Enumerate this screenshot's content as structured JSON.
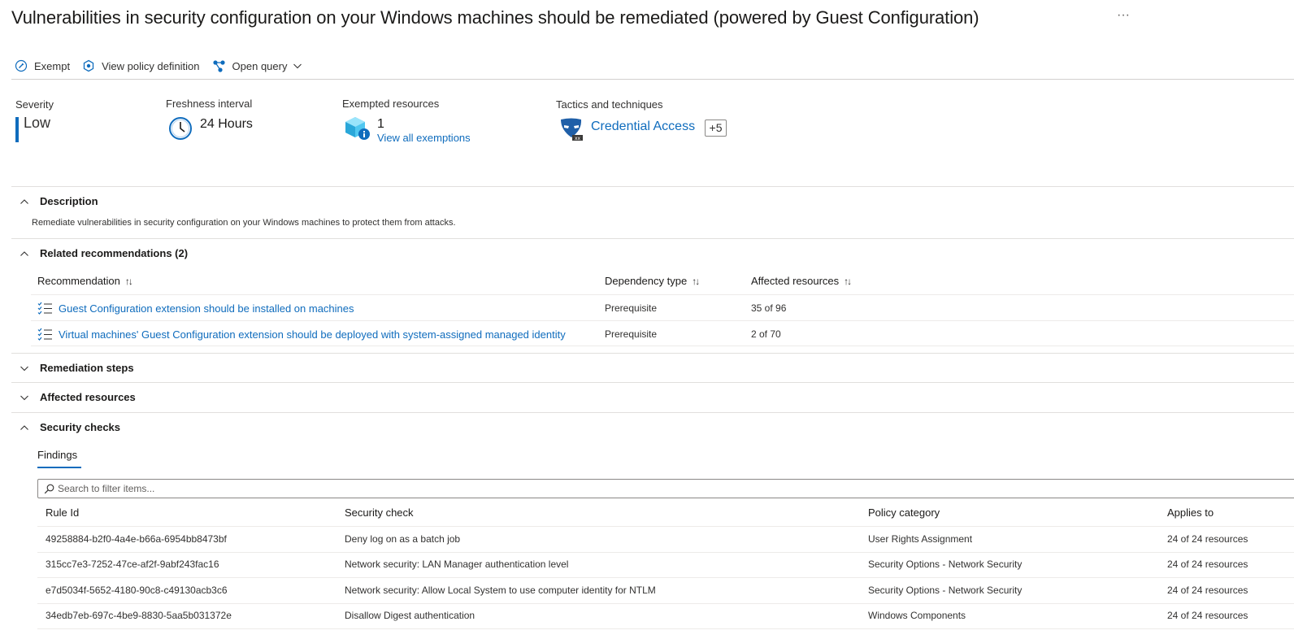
{
  "page": {
    "title": "Vulnerabilities in security configuration on your Windows machines should be remediated (powered by Guest Configuration)",
    "more": "···"
  },
  "toolbar": {
    "exempt": "Exempt",
    "view_policy": "View policy definition",
    "open_query": "Open query"
  },
  "summary": {
    "severity_label": "Severity",
    "severity_value": "Low",
    "freshness_label": "Freshness interval",
    "freshness_value": "24 Hours",
    "exempted_label": "Exempted resources",
    "exempted_count": "1",
    "exempted_link": "View all exemptions",
    "tactics_label": "Tactics and techniques",
    "tactics_value": "Credential Access",
    "tactics_more": "+5"
  },
  "description": {
    "title": "Description",
    "text": "Remediate vulnerabilities in security configuration on your Windows machines to protect them from attacks."
  },
  "related": {
    "title": "Related recommendations (2)",
    "headers": [
      "Recommendation",
      "Dependency type",
      "Affected resources"
    ],
    "sort_glyph": "↑↓",
    "rows": [
      {
        "recommendation": "Guest Configuration extension should be installed on machines",
        "dependency": "Prerequisite",
        "affected": "35 of 96"
      },
      {
        "recommendation": "Virtual machines' Guest Configuration extension should be deployed with system-assigned managed identity",
        "dependency": "Prerequisite",
        "affected": "2 of 70"
      }
    ]
  },
  "remediation": {
    "title": "Remediation steps"
  },
  "affected": {
    "title": "Affected resources"
  },
  "security_checks": {
    "title": "Security checks",
    "tab": "Findings",
    "filter_placeholder": "Search to filter items...",
    "headers": [
      "Rule Id",
      "Security check",
      "Policy category",
      "Applies to"
    ],
    "rows": [
      {
        "rule_id": "49258884-b2f0-4a4e-b66a-6954bb8473bf",
        "check": "Deny log on as a batch job",
        "category": "User Rights Assignment",
        "applies": "24 of 24 resources"
      },
      {
        "rule_id": "315cc7e3-7252-47ce-af2f-9abf243fac16",
        "check": "Network security: LAN Manager authentication level",
        "category": "Security Options - Network Security",
        "applies": "24 of 24 resources"
      },
      {
        "rule_id": "e7d5034f-5652-4180-90c8-c49130acb3c6",
        "check": "Network security: Allow Local System to use computer identity for NTLM",
        "category": "Security Options - Network Security",
        "applies": "24 of 24 resources"
      },
      {
        "rule_id": "34edb7eb-697c-4be9-8830-5aa5b031372e",
        "check": "Disallow Digest authentication",
        "category": "Windows Components",
        "applies": "24 of 24 resources"
      }
    ]
  },
  "colors": {
    "accent": "#0f6cbd",
    "text": "#323130",
    "border": "#e1dfdd"
  },
  "icons": [
    "exempt-icon",
    "policy-icon",
    "query-icon",
    "chevron-down-icon",
    "clock-icon",
    "cube-info-icon",
    "mask-icon",
    "chevron-up-icon",
    "list-check-icon",
    "search-icon"
  ]
}
